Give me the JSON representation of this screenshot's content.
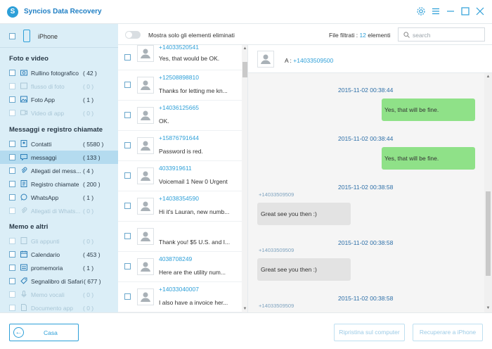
{
  "app": {
    "title": "Syncios Data Recovery",
    "accent_color": "#2d9fd8",
    "window_controls": [
      "gear-icon",
      "menu-icon",
      "minimize-icon",
      "maximize-icon",
      "close-icon"
    ]
  },
  "sidebar": {
    "device": "iPhone",
    "sections": [
      {
        "title": "Foto e video",
        "items": [
          {
            "label": "Rullino fotografico",
            "count": "( 42 )",
            "icon": "camera-icon",
            "enabled": true
          },
          {
            "label": "flusso di foto",
            "count": "( 0 )",
            "icon": "photo-stream-icon",
            "enabled": false
          },
          {
            "label": "Foto App",
            "count": "( 1 )",
            "icon": "image-icon",
            "enabled": true
          },
          {
            "label": "Video di app",
            "count": "( 0 )",
            "icon": "video-icon",
            "enabled": false
          }
        ]
      },
      {
        "title": "Messaggi e registro chiamate",
        "items": [
          {
            "label": "Contatti",
            "count": "( 5580 )",
            "icon": "contact-icon",
            "enabled": true
          },
          {
            "label": "messaggi",
            "count": "( 133 )",
            "icon": "message-icon",
            "enabled": true,
            "selected": true
          },
          {
            "label": "Allegati del mess...",
            "count": "( 4 )",
            "icon": "attachment-icon",
            "enabled": true
          },
          {
            "label": "Registro chiamate",
            "count": "( 200 )",
            "icon": "call-log-icon",
            "enabled": true
          },
          {
            "label": "WhatsApp",
            "count": "( 1 )",
            "icon": "whatsapp-icon",
            "enabled": true
          },
          {
            "label": "Allegati di Whats...",
            "count": "( 0 )",
            "icon": "attachment-icon",
            "enabled": false
          }
        ]
      },
      {
        "title": "Memo e altri",
        "items": [
          {
            "label": "Gli appunti",
            "count": "( 0 )",
            "icon": "notes-icon",
            "enabled": false
          },
          {
            "label": "Calendario",
            "count": "( 453 )",
            "icon": "calendar-icon",
            "enabled": true
          },
          {
            "label": "promemoria",
            "count": "( 1 )",
            "icon": "reminder-icon",
            "enabled": true
          },
          {
            "label": "Segnalibro di Safari",
            "count": "( 677 )",
            "icon": "bookmark-icon",
            "enabled": true
          },
          {
            "label": "Memo vocali",
            "count": "( 0 )",
            "icon": "voice-memo-icon",
            "enabled": false
          },
          {
            "label": "Documento app",
            "count": "( 0 )",
            "icon": "document-icon",
            "enabled": false
          }
        ]
      }
    ]
  },
  "toolbar": {
    "toggle_label": "Mostra solo gli elementi eliminati",
    "filter_prefix": "File filtrati : ",
    "filter_count": "12",
    "filter_suffix": " elementi",
    "search_placeholder": "search"
  },
  "messages": [
    {
      "phone": "+14033520541",
      "text": "Yes, that would be OK."
    },
    {
      "phone": "+12508898810",
      "text": "Thanks for letting me kn..."
    },
    {
      "phone": "+14036125665",
      "text": "OK."
    },
    {
      "phone": "+15876791644",
      "text": "Password is red."
    },
    {
      "phone": "4033919611",
      "text": "Voicemail 1 New 0 Urgent"
    },
    {
      "phone": "+14038354590",
      "text": "Hi it's Lauran, new numb..."
    },
    {
      "phone": "",
      "text": "Thank you! $5 U.S. and I..."
    },
    {
      "phone": "4038708249",
      "text": "Here are the utility num..."
    },
    {
      "phone": "+14033040007",
      "text": "I also have a invoice her..."
    }
  ],
  "detail": {
    "to_prefix": "A : ",
    "to_phone": "+14033509500",
    "conversation": [
      {
        "type": "out",
        "timestamp": "2015-11-02 00:38:44",
        "text": "Yes, that will be fine."
      },
      {
        "type": "out",
        "timestamp": "2015-11-02 00:38:44",
        "text": "Yes, that will be fine."
      },
      {
        "type": "in",
        "timestamp": "2015-11-02 00:38:58",
        "sender": "+14033509509",
        "text": "Great see you then :)"
      },
      {
        "type": "in",
        "timestamp": "2015-11-02 00:38:58",
        "sender": "+14033509509",
        "text": "Great see you then :)"
      },
      {
        "type": "in",
        "timestamp": "2015-11-02 00:38:58",
        "sender": "+14033509509",
        "text": ""
      }
    ]
  },
  "footer": {
    "home_label": "Casa",
    "restore_label": "Ripristina sul computer",
    "recover_label": "Recuperare a iPhone"
  }
}
